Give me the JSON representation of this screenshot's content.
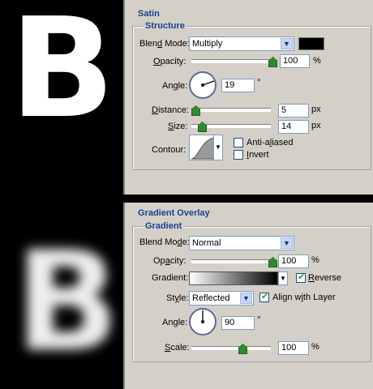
{
  "preview": {
    "letter": "B"
  },
  "satin": {
    "title": "Satin",
    "group": "Structure",
    "blend_mode": {
      "label_pre": "Blen",
      "label_u": "d",
      "label_post": " Mode:",
      "value": "Multiply"
    },
    "swatch_color": "#000000",
    "opacity": {
      "label_u": "O",
      "label_post": "pacity:",
      "value": "100",
      "unit": "%",
      "level": 1.0
    },
    "angle": {
      "label_pre": "An",
      "label_u": "g",
      "label_post": "le:",
      "value": "19",
      "unit": "°"
    },
    "distance": {
      "label_u": "D",
      "label_post": "istance:",
      "value": "5",
      "unit": "px",
      "level": 0.0
    },
    "size": {
      "label_u": "S",
      "label_post": "ize:",
      "value": "14",
      "unit": "px",
      "level": 0.1
    },
    "contour": {
      "label": "Contour:"
    },
    "anti_aliased": {
      "label_pre": "Anti-a",
      "label_u": "l",
      "label_post": "iased",
      "checked": false
    },
    "invert": {
      "label_u": "I",
      "label_post": "nvert",
      "checked": false
    }
  },
  "gradient_overlay": {
    "title": "Gradient Overlay",
    "group": "Gradient",
    "blend_mode": {
      "label_pre": "Blend Mo",
      "label_u": "d",
      "label_post": "e:",
      "value": "Normal"
    },
    "opacity": {
      "label_pre": "Op",
      "label_u": "a",
      "label_post": "city:",
      "value": "100",
      "unit": "%",
      "level": 1.0
    },
    "gradient": {
      "label": "Gradient:"
    },
    "reverse": {
      "label_u": "R",
      "label_post": "everse",
      "checked": true
    },
    "style": {
      "label_pre": "St",
      "label_u": "y",
      "label_post": "le:",
      "value": "Reflected"
    },
    "align": {
      "label_pre": "Align w",
      "label_u": "i",
      "label_post": "th Layer",
      "checked": true
    },
    "angle": {
      "label_pre": "Angle",
      "label_u": "",
      "label_post": ":",
      "value": "90",
      "unit": "°"
    },
    "scale": {
      "label_u": "S",
      "label_post": "cale:",
      "value": "100",
      "unit": "%",
      "level": 0.67
    }
  }
}
